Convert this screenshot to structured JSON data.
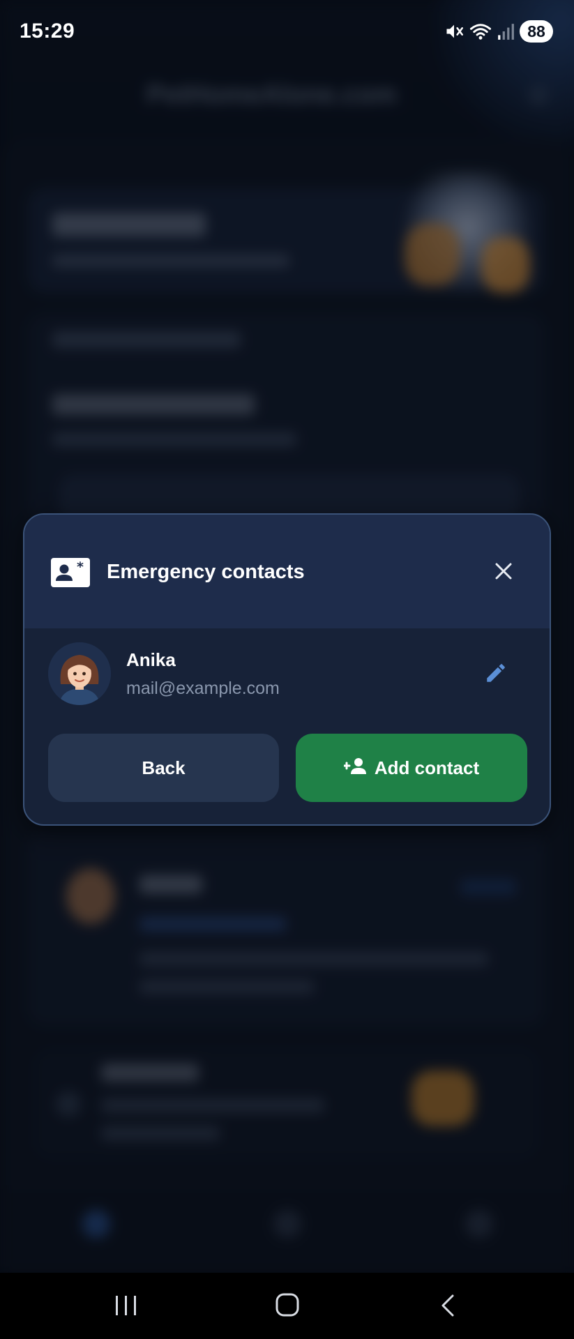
{
  "status_bar": {
    "time": "15:29",
    "battery": "88",
    "icons": [
      "mute-icon",
      "wifi-icon",
      "signal-icon",
      "battery-icon"
    ]
  },
  "background": {
    "title": "PetHomeAlone.com"
  },
  "dialog": {
    "title": "Emergency contacts",
    "header_icon": "contact-card-icon",
    "close_icon": "close-icon",
    "contact": {
      "name": "Anika",
      "email": "mail@example.com",
      "edit_icon": "edit-pencil-icon"
    },
    "back_label": "Back",
    "add_label": "Add contact",
    "add_icon": "person-add-icon"
  },
  "colors": {
    "accent_green": "#1f8147",
    "dialog_header": "#1e2c4b",
    "dialog_body": "#172238",
    "edit_blue": "#5b8fd6"
  },
  "system_nav": {
    "icons": [
      "recent-apps-icon",
      "home-icon",
      "back-icon"
    ]
  }
}
